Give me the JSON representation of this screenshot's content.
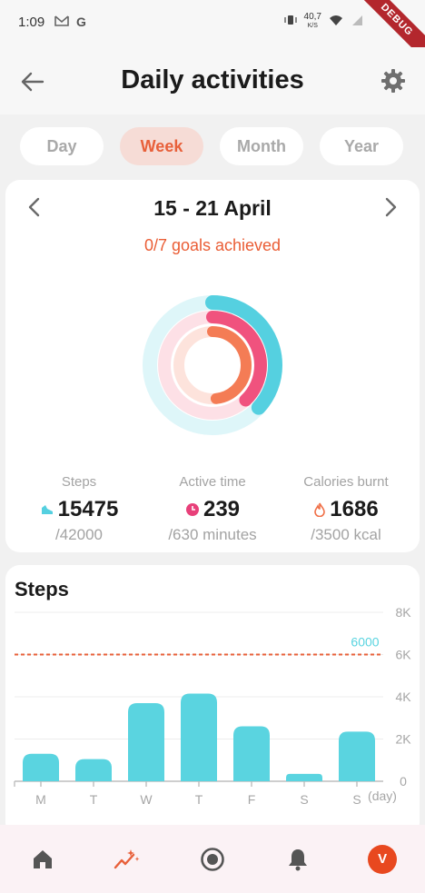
{
  "status_bar": {
    "time": "1:09",
    "left_icons": [
      "gmail-icon",
      "google-icon"
    ],
    "speed": "40,7",
    "speed_unit": "K/S",
    "debug_label": "DEBUG"
  },
  "header": {
    "title": "Daily activities"
  },
  "tabs": [
    {
      "label": "Day",
      "active": false
    },
    {
      "label": "Week",
      "active": true
    },
    {
      "label": "Month",
      "active": false
    },
    {
      "label": "Year",
      "active": false
    }
  ],
  "summary": {
    "range": "15 - 21 April",
    "goals": "0/7 goals achieved",
    "rings": [
      {
        "name": "steps",
        "progress": 0.368,
        "color": "#55d0e0",
        "track": "#def6f9"
      },
      {
        "name": "active-time",
        "progress": 0.379,
        "color": "#f0527e",
        "track": "#fde0e6"
      },
      {
        "name": "calories",
        "progress": 0.482,
        "color": "#f47c55",
        "track": "#fde3dc"
      }
    ],
    "stats": {
      "steps": {
        "label": "Steps",
        "value": "15475",
        "goal": "/42000"
      },
      "active": {
        "label": "Active time",
        "value": "239",
        "goal": "/630 minutes"
      },
      "calories": {
        "label": "Calories burnt",
        "value": "1686",
        "goal": "/3500 kcal"
      }
    }
  },
  "steps_chart": {
    "title": "Steps",
    "chart_data": {
      "type": "bar",
      "categories": [
        "M",
        "T",
        "W",
        "T",
        "F",
        "S",
        "S"
      ],
      "values": [
        1300,
        1050,
        3700,
        4150,
        2600,
        350,
        2350
      ],
      "ylim": [
        0,
        8000
      ],
      "yticks": [
        "0",
        "2K",
        "4K",
        "6K",
        "8K"
      ],
      "x_unit": "(day)",
      "goal_line": {
        "value": 6000,
        "label": "6000",
        "color": "#e8603a"
      },
      "bar_color": "#5ad4e0",
      "grid": true
    }
  },
  "bottom_nav": {
    "items": [
      "home-icon",
      "activity-icon",
      "record-icon",
      "notifications-icon"
    ],
    "avatar_letter": "V"
  }
}
